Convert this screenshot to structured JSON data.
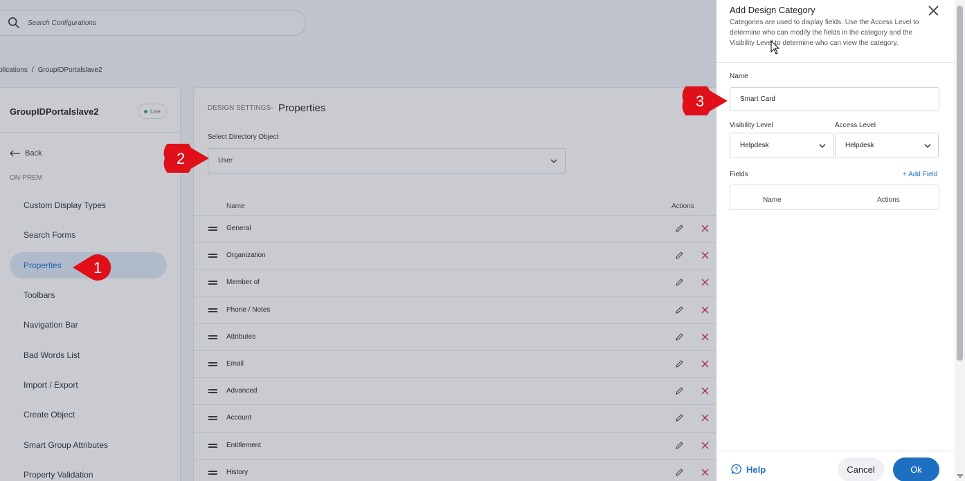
{
  "search": {
    "placeholder": "Search Configurations"
  },
  "breadcrumb": {
    "parent": "Applications",
    "current": "GroupIDPortalslave2"
  },
  "sidebar": {
    "title": "GroupIDPortalslave2",
    "badge": "Live",
    "back": "Back",
    "section": "ON-PREM",
    "items": [
      {
        "label": "Custom Display Types"
      },
      {
        "label": "Search Forms"
      },
      {
        "label": "Properties"
      },
      {
        "label": "Toolbars"
      },
      {
        "label": "Navigation Bar"
      },
      {
        "label": "Bad Words List"
      },
      {
        "label": "Import / Export"
      },
      {
        "label": "Create Object"
      },
      {
        "label": "Smart Group Attributes"
      },
      {
        "label": "Property Validation"
      }
    ]
  },
  "main": {
    "section_label": "DESIGN SETTINGS",
    "separator": "-",
    "title": "Properties",
    "select_label": "Select Directory Object",
    "select_value": "User",
    "columns": {
      "name": "Name",
      "actions": "Actions"
    },
    "rows": [
      "General",
      "Organization",
      "Member of",
      "Phone / Notes",
      "Attributes",
      "Email",
      "Advanced",
      "Account",
      "Entitlement",
      "History"
    ]
  },
  "panel": {
    "title": "Add Design Category",
    "description": "Categories are used to display fields. Use the Access Level to determine who can modify the fields in the category and the Visibility Level to determine who can view the category.",
    "name_label": "Name",
    "name_value": "Smart Card",
    "visibility_label": "Visibility Level",
    "visibility_value": "Helpdesk",
    "access_label": "Access Level",
    "access_value": "Helpdesk",
    "fields_label": "Fields",
    "add_field": "+ Add Field",
    "fields_columns": {
      "name": "Name",
      "actions": "Actions"
    },
    "help": "Help",
    "cancel": "Cancel",
    "ok": "Ok"
  },
  "markers": [
    "1",
    "2",
    "3"
  ],
  "colors": {
    "accent": "#1d6fc2",
    "marker": "#e0101a",
    "delete": "#d0333a"
  }
}
